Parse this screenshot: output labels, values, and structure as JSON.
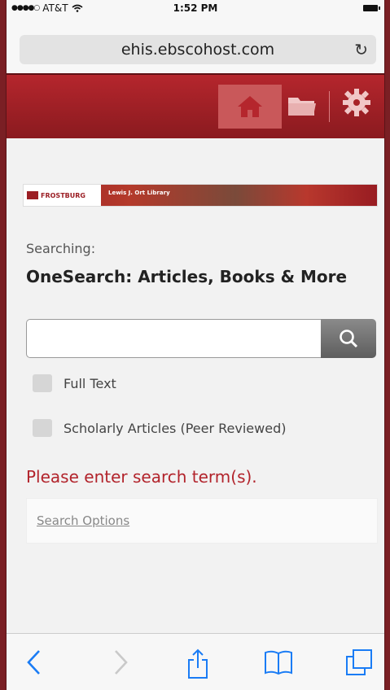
{
  "status_bar": {
    "carrier": "AT&T",
    "time": "1:52 PM"
  },
  "browser": {
    "url": "ehis.ebscohost.com"
  },
  "banner": {
    "logo_text": "FROSTBURG",
    "library_name": "Lewis J. Ort Library"
  },
  "search": {
    "searching_label": "Searching:",
    "database": "OneSearch: Articles, Books & More",
    "input_value": "",
    "full_text_label": "Full Text",
    "scholarly_label": "Scholarly Articles (Peer Reviewed)",
    "error_message": "Please enter search term(s).",
    "options_link": "Search Options"
  },
  "colors": {
    "brand_red": "#b5262d",
    "error_red": "#b2232b",
    "tool_blue": "#1a7cf5"
  },
  "icons": [
    "wifi-icon",
    "battery-icon",
    "reload-icon",
    "home-icon",
    "folder-icon",
    "gear-icon",
    "search-icon",
    "back-icon",
    "forward-icon",
    "share-icon",
    "bookmarks-icon",
    "tabs-icon"
  ]
}
